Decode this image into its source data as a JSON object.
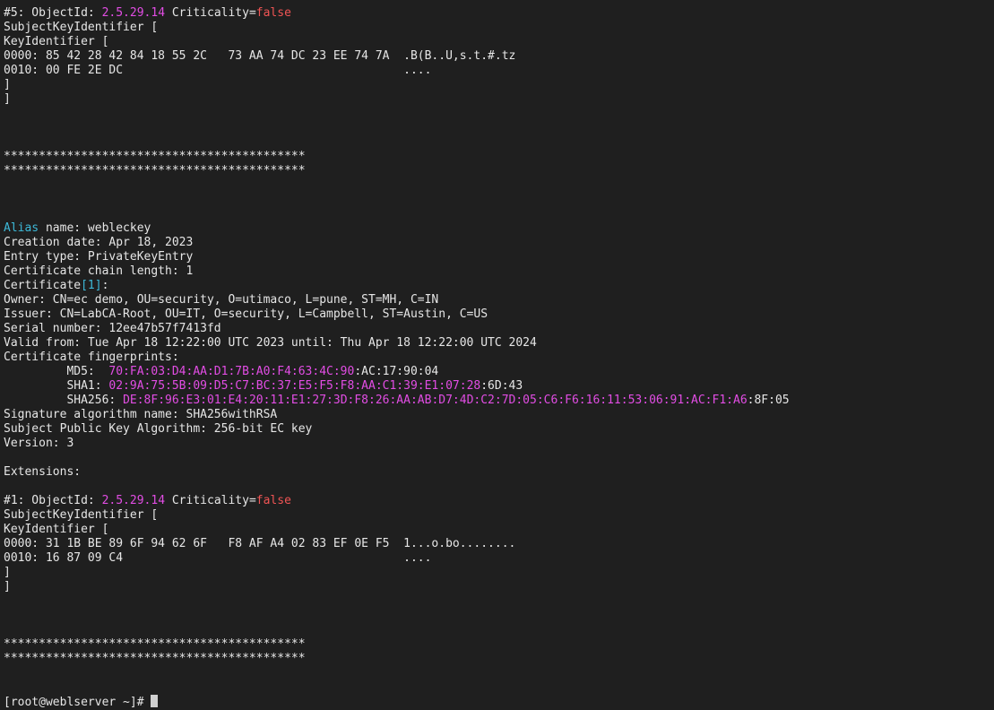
{
  "terminal": {
    "lines": [
      [
        {
          "t": "#5: ObjectId: "
        },
        {
          "t": "2.5.29.14",
          "c": "magenta"
        },
        {
          "t": " Criticality="
        },
        {
          "t": "false",
          "c": "red"
        }
      ],
      [
        {
          "t": "SubjectKeyIdentifier ["
        }
      ],
      [
        {
          "t": "KeyIdentifier ["
        }
      ],
      [
        {
          "t": "0000: 85 42 28 42 84 18 55 2C   73 AA 74 DC 23 EE 74 7A  .B(B..U,s.t.#.tz"
        }
      ],
      [
        {
          "t": "0010: 00 FE 2E DC                                        ...."
        }
      ],
      [
        {
          "t": "]"
        }
      ],
      [
        {
          "t": "]"
        }
      ],
      [],
      [],
      [],
      [
        {
          "t": "*******************************************"
        }
      ],
      [
        {
          "t": "*******************************************"
        }
      ],
      [],
      [],
      [],
      [
        {
          "t": "Alias",
          "c": "cyan"
        },
        {
          "t": " name: webleckey"
        }
      ],
      [
        {
          "t": "Creation date: Apr 18, 2023"
        }
      ],
      [
        {
          "t": "Entry type: PrivateKeyEntry"
        }
      ],
      [
        {
          "t": "Certificate chain length: 1"
        }
      ],
      [
        {
          "t": "Certificate"
        },
        {
          "t": "[1]",
          "c": "cyan"
        },
        {
          "t": ":"
        }
      ],
      [
        {
          "t": "Owner: CN=ec demo, OU=security, O=utimaco, L=pune, ST=MH, C=IN"
        }
      ],
      [
        {
          "t": "Issuer: CN=LabCA-Root, OU=IT, O=security, L=Campbell, ST=Austin, C=US"
        }
      ],
      [
        {
          "t": "Serial number: 12ee47b57f7413fd"
        }
      ],
      [
        {
          "t": "Valid from: Tue Apr 18 12:22:00 UTC 2023 until: Thu Apr 18 12:22:00 UTC 2024"
        }
      ],
      [
        {
          "t": "Certificate fingerprints:"
        }
      ],
      [
        {
          "t": "         MD5:  "
        },
        {
          "t": "70:FA:03:D4:AA:D1:7B:A0:F4:63:4C:90",
          "c": "magenta"
        },
        {
          "t": ":AC:17:90:04"
        }
      ],
      [
        {
          "t": "         SHA1: "
        },
        {
          "t": "02:9A:75:5B:09:D5:C7:BC:37:E5:F5:F8:AA:C1:39:E1:07:28",
          "c": "magenta"
        },
        {
          "t": ":6D:43"
        }
      ],
      [
        {
          "t": "         SHA256: "
        },
        {
          "t": "DE:8F:96:E3:01:E4:20:11:E1:27:3D:F8",
          "c": "magenta"
        },
        {
          "t": ":26:AA:AB:D7:4D:C2:7D:05:C6:F6:16:11:53:06:91:AC:F1:A6",
          "c": "magenta"
        },
        {
          "t": ":8F:05"
        }
      ],
      [
        {
          "t": "Signature algorithm name: SHA256withRSA"
        }
      ],
      [
        {
          "t": "Subject Public Key Algorithm: 256-bit EC key"
        }
      ],
      [
        {
          "t": "Version: 3"
        }
      ],
      [],
      [
        {
          "t": "Extensions:"
        }
      ],
      [],
      [
        {
          "t": "#1: ObjectId: "
        },
        {
          "t": "2.5.29.14",
          "c": "magenta"
        },
        {
          "t": " Criticality="
        },
        {
          "t": "false",
          "c": "red"
        }
      ],
      [
        {
          "t": "SubjectKeyIdentifier ["
        }
      ],
      [
        {
          "t": "KeyIdentifier ["
        }
      ],
      [
        {
          "t": "0000: 31 1B BE 89 6F 94 62 6F   F8 AF A4 02 83 EF 0E F5  1...o.bo........"
        }
      ],
      [
        {
          "t": "0010: 16 87 09 C4                                        ...."
        }
      ],
      [
        {
          "t": "]"
        }
      ],
      [
        {
          "t": "]"
        }
      ],
      [],
      [],
      [],
      [
        {
          "t": "*******************************************"
        }
      ],
      [
        {
          "t": "*******************************************"
        }
      ],
      [],
      []
    ],
    "prompt": "[root@weblserver ~]# ",
    "colors": {
      "background": "#1f1f1f",
      "foreground": "#e6e6e6",
      "magenta": "#e24de4",
      "red": "#f05454",
      "cyan": "#3db9d8"
    }
  }
}
